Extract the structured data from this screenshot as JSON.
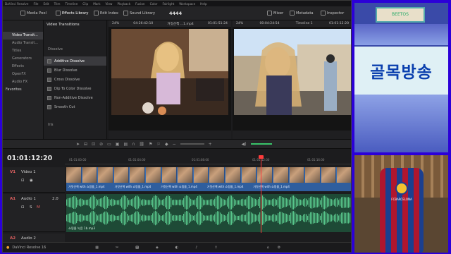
{
  "menu": [
    "DaVinci Resolve",
    "File",
    "Edit",
    "Trim",
    "Timeline",
    "Clip",
    "Mark",
    "View",
    "Playback",
    "Fusion",
    "Color",
    "Fairlight",
    "Workspace",
    "Help"
  ],
  "toolbar": {
    "media_pool": "Media Pool",
    "effects_library": "Effects Library",
    "edit_index": "Edit Index",
    "sound_library": "Sound Library",
    "project_title": "4444",
    "mixer": "Mixer",
    "metadata": "Metadata",
    "inspector": "Inspector"
  },
  "left_panel": {
    "items": [
      "Video Transit...",
      "Audio Transit...",
      "Titles",
      "Generators",
      "Effects",
      "OpenFX",
      "Audio FX"
    ],
    "favorites": "Favorites"
  },
  "effects": {
    "heading": "Video Transitions",
    "group": "Dissolve",
    "items": [
      "Additive Dissolve",
      "Blur Dissolve",
      "Cross Dissolve",
      "Dip To Color Dissolve",
      "Non-Additive Dissolve",
      "Smooth Cut"
    ],
    "next_group": "Iris"
  },
  "source_viewer": {
    "zoom": "24%",
    "timecode": "04:26:42:10",
    "clip": "거짓산책 ...1.mp4",
    "tc_right": "01:01:51:24"
  },
  "timeline_viewer": {
    "zoom": "24%",
    "timecode": "00:04:24:54",
    "name": "Timeline 1",
    "tc_right": "01:01:12:20"
  },
  "timeline": {
    "timecode": "01:01:12:20",
    "ruler": [
      "01:01:00:00",
      "01:01:04:00",
      "01:01:08:00",
      "01:01:12:00",
      "01:01:16:00"
    ],
    "video_track": {
      "id": "V1",
      "name": "Video 1"
    },
    "audio_track": {
      "id": "A1",
      "name": "Audio 1",
      "mix": "2.0"
    },
    "audio2": {
      "id": "A2",
      "name": "Audio 2"
    },
    "video_clip_label": "거짓산책 with 쇼핑몰_1.mp4",
    "audio_clip_label": "쇼핑몰 녹음 1b.mp3"
  },
  "footer": {
    "app": "DaVinci Resolve 16"
  },
  "cam1": {
    "sign_text": "골목방송",
    "board_text": "BEETOS"
  },
  "cam2": {
    "chair_text": "FCBARCELONA"
  },
  "colors": {
    "accent": "#ff3b3b",
    "frame_bg": "#2b00d8",
    "clip_video": "#3b6fb0",
    "clip_audio": "#1e4a36"
  }
}
